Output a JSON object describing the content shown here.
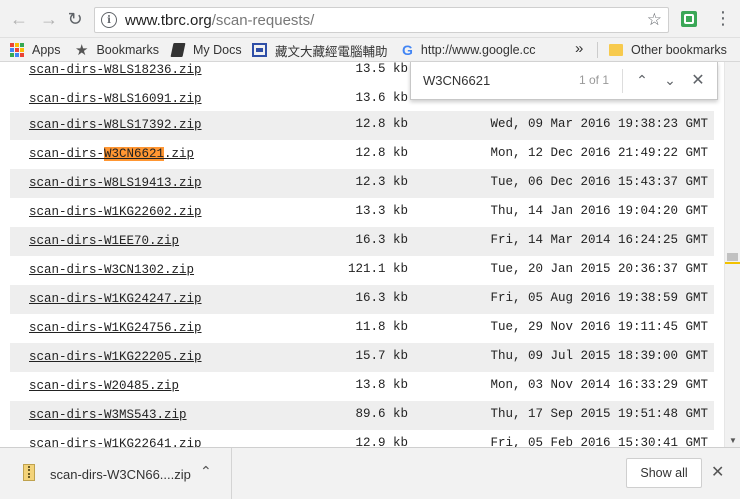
{
  "browser": {
    "url_host": "www.tbrc.org",
    "url_path": "/scan-requests/",
    "bookmarks": [
      {
        "label": "Apps",
        "icon": "apps-grid-icon"
      },
      {
        "label": "Bookmarks",
        "icon": "star-icon"
      },
      {
        "label": "My Docs",
        "icon": "docs-icon"
      },
      {
        "label": "藏文大藏經電腦輔助",
        "icon": "tbrc-icon"
      },
      {
        "label": "http://www.google.cc",
        "icon": "google-icon"
      },
      {
        "label": "Other bookmarks",
        "icon": "folder-icon"
      }
    ],
    "more_bookmarks": "»"
  },
  "find": {
    "query": "W3CN6621",
    "count": "1 of 1"
  },
  "files": [
    {
      "name": "scan-dirs-W8LS18236.zip",
      "size": "13.5 kb",
      "date": ""
    },
    {
      "name": "scan-dirs-W8LS16091.zip",
      "size": "13.6 kb",
      "date": ""
    },
    {
      "name": "scan-dirs-W8LS17392.zip",
      "size": "12.8 kb",
      "date": "Wed, 09 Mar 2016 19:38:23 GMT"
    },
    {
      "name_pre": "scan-dirs-",
      "name_hl": "W3CN6621",
      "name_post": ".zip",
      "size": "12.8 kb",
      "date": "Mon, 12 Dec 2016 21:49:22 GMT"
    },
    {
      "name": "scan-dirs-W8LS19413.zip",
      "size": "12.3 kb",
      "date": "Tue, 06 Dec 2016 15:43:37 GMT"
    },
    {
      "name": "scan-dirs-W1KG22602.zip",
      "size": "13.3 kb",
      "date": "Thu, 14 Jan 2016 19:04:20 GMT"
    },
    {
      "name": "scan-dirs-W1EE70.zip",
      "size": "16.3 kb",
      "date": "Fri, 14 Mar 2014 16:24:25 GMT"
    },
    {
      "name": "scan-dirs-W3CN1302.zip",
      "size": "121.1 kb",
      "date": "Tue, 20 Jan 2015 20:36:37 GMT"
    },
    {
      "name": "scan-dirs-W1KG24247.zip",
      "size": "16.3 kb",
      "date": "Fri, 05 Aug 2016 19:38:59 GMT"
    },
    {
      "name": "scan-dirs-W1KG24756.zip",
      "size": "11.8 kb",
      "date": "Tue, 29 Nov 2016 19:11:45 GMT"
    },
    {
      "name": "scan-dirs-W1KG22205.zip",
      "size": "15.7 kb",
      "date": "Thu, 09 Jul 2015 18:39:00 GMT"
    },
    {
      "name": "scan-dirs-W20485.zip",
      "size": "13.8 kb",
      "date": "Mon, 03 Nov 2014 16:33:29 GMT"
    },
    {
      "name": "scan-dirs-W3MS543.zip",
      "size": "89.6 kb",
      "date": "Thu, 17 Sep 2015 19:51:48 GMT"
    },
    {
      "name": "scan-dirs-W1KG22641.zip",
      "size": "12.9 kb",
      "date": "Fri, 05 Feb 2016 15:30:41 GMT"
    }
  ],
  "downloads": {
    "item_name": "scan-dirs-W3CN66....zip",
    "show_all": "Show all"
  },
  "colors": {
    "find_highlight": "#ff9632",
    "row_alt": "#eeeeee",
    "scroll_match_marker": "#f2c200"
  }
}
